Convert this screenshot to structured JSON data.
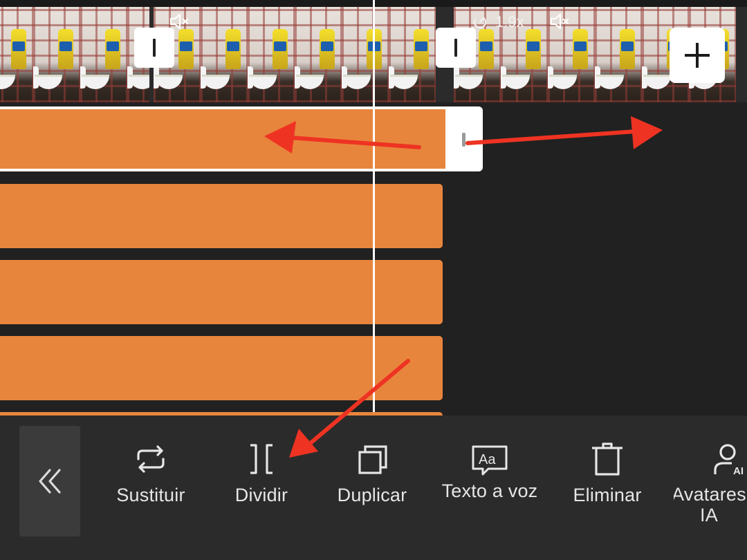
{
  "timeline": {
    "speed_label": "1.9x",
    "add_icon": "plus-icon",
    "mute_icon": "speaker-muted-icon",
    "speed_icon": "speed-dial-icon"
  },
  "toolbar": {
    "collapse_icon": "double-chevron-left-icon",
    "items": [
      {
        "label": "Sustituir",
        "icon": "replace-icon"
      },
      {
        "label": "Dividir",
        "icon": "split-icon"
      },
      {
        "label": "Duplicar",
        "icon": "duplicate-icon"
      },
      {
        "label": "Texto a voz",
        "icon": "text-to-speech-icon"
      },
      {
        "label": "Eliminar",
        "icon": "trash-icon"
      },
      {
        "label": "Avatares IA",
        "icon": "ai-avatar-icon"
      }
    ]
  },
  "colors": {
    "track": "#e8853d",
    "background": "#212121",
    "toolbar": "#2b2b2b",
    "annotation_arrow": "#ee3322"
  }
}
